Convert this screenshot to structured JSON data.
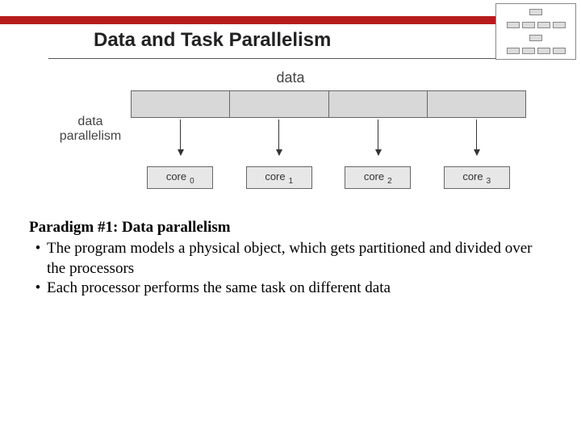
{
  "title": "Data and Task Parallelism",
  "diagram": {
    "top_label": "data",
    "side_label_line1": "data",
    "side_label_line2": "parallelism",
    "core_prefix": "core",
    "cores": [
      "0",
      "1",
      "2",
      "3"
    ]
  },
  "body": {
    "heading": "Paradigm #1: Data parallelism",
    "bullets": [
      "The program models a physical object, which gets partitioned and divided over the processors",
      "Each processor performs the same task on different data"
    ]
  }
}
